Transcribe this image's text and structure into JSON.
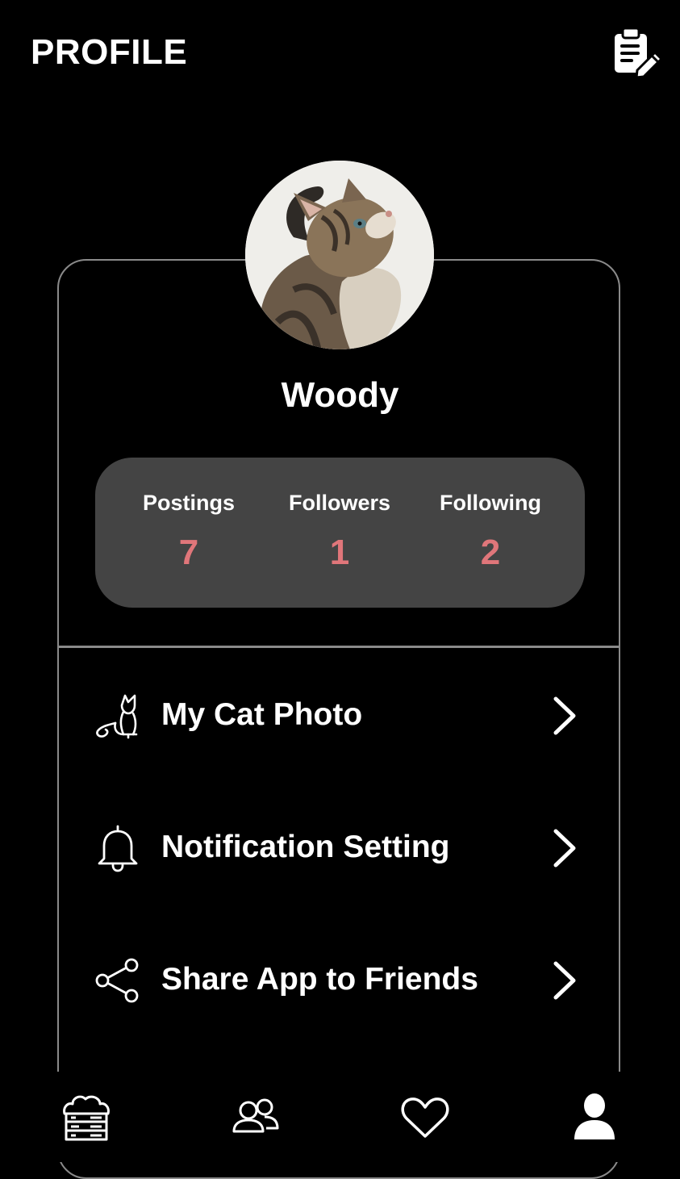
{
  "header": {
    "title": "PROFILE",
    "edit_icon": "clipboard-edit-icon"
  },
  "profile": {
    "name": "Woody",
    "avatar": "cat-kitten-photo"
  },
  "stats": [
    {
      "label": "Postings",
      "value": "7"
    },
    {
      "label": "Followers",
      "value": "1"
    },
    {
      "label": "Following",
      "value": "2"
    }
  ],
  "menu": [
    {
      "label": "My Cat Photo",
      "icon": "cat-icon"
    },
    {
      "label": "Notification Setting",
      "icon": "bell-icon"
    },
    {
      "label": "Share App to Friends",
      "icon": "share-icon"
    }
  ],
  "bottom_nav": [
    {
      "name": "home",
      "icon": "cat-house-icon"
    },
    {
      "name": "friends",
      "icon": "users-icon"
    },
    {
      "name": "likes",
      "icon": "heart-icon"
    },
    {
      "name": "profile",
      "icon": "user-icon",
      "active": true
    }
  ],
  "colors": {
    "background": "#000000",
    "stats_box": "#444444",
    "stat_value": "#e0767a",
    "card_border": "#8a8a8a",
    "text": "#ffffff"
  }
}
